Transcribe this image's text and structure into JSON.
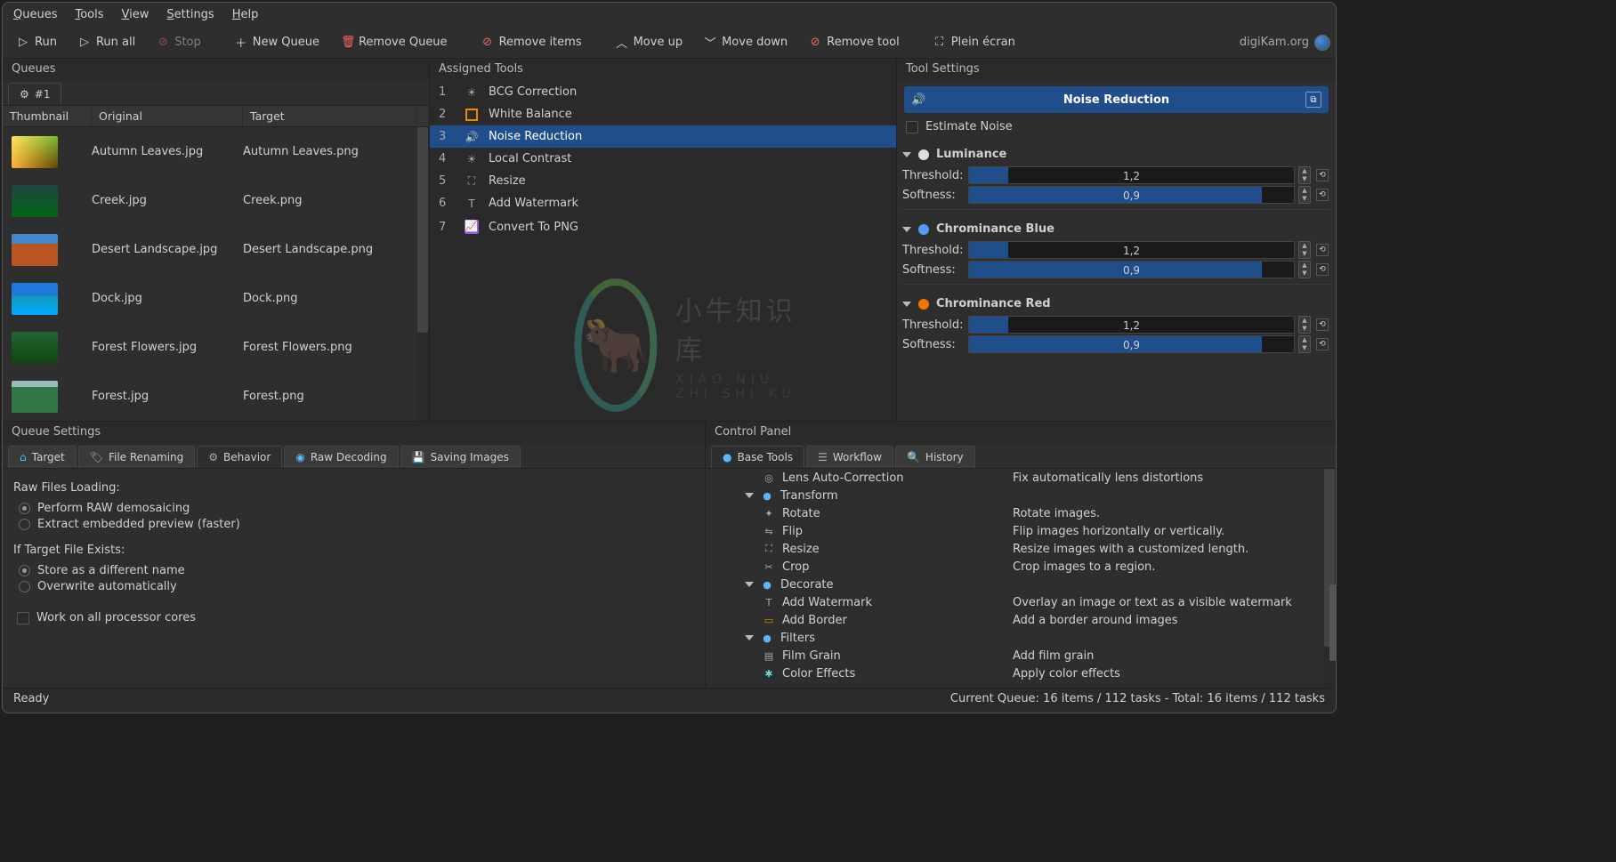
{
  "menubar": [
    "Queues",
    "Tools",
    "View",
    "Settings",
    "Help"
  ],
  "toolbar": {
    "run": "Run",
    "runall": "Run all",
    "stop": "Stop",
    "newqueue": "New Queue",
    "removequeue": "Remove Queue",
    "removeitems": "Remove items",
    "moveup": "Move up",
    "movedown": "Move down",
    "removetool": "Remove tool",
    "fullscreen": "Plein écran",
    "brand": "digiKam.org"
  },
  "queues": {
    "title": "Queues",
    "tab": "#1",
    "columns": {
      "thumb": "Thumbnail",
      "orig": "Original",
      "target": "Target"
    },
    "rows": [
      {
        "t": "t1",
        "o": "Autumn Leaves.jpg",
        "g": "Autumn Leaves.png"
      },
      {
        "t": "t2",
        "o": "Creek.jpg",
        "g": "Creek.png"
      },
      {
        "t": "t3",
        "o": "Desert Landscape.jpg",
        "g": "Desert Landscape.png"
      },
      {
        "t": "t4",
        "o": "Dock.jpg",
        "g": "Dock.png"
      },
      {
        "t": "t5",
        "o": "Forest Flowers.jpg",
        "g": "Forest Flowers.png"
      },
      {
        "t": "t6",
        "o": "Forest.jpg",
        "g": "Forest.png"
      }
    ]
  },
  "assigned": {
    "title": "Assigned Tools",
    "rows": [
      {
        "n": "1",
        "name": "BCG Correction",
        "icon": "sun"
      },
      {
        "n": "2",
        "name": "White Balance",
        "icon": "sq-orange"
      },
      {
        "n": "3",
        "name": "Noise Reduction",
        "icon": "speaker",
        "sel": true
      },
      {
        "n": "4",
        "name": "Local Contrast",
        "icon": "sun"
      },
      {
        "n": "5",
        "name": "Resize",
        "icon": "resize"
      },
      {
        "n": "6",
        "name": "Add Watermark",
        "icon": "text"
      },
      {
        "n": "7",
        "name": "Convert To PNG",
        "icon": "sq-purple"
      }
    ],
    "wm_big": "小牛知识库",
    "wm_sub": "XIAO NIU ZHI SHI KU"
  },
  "toolsettings": {
    "title": "Tool Settings",
    "header": "Noise Reduction",
    "estimate": "Estimate Noise",
    "groups": [
      {
        "name": "Luminance",
        "bulb": "#ddd",
        "rows": [
          {
            "lab": "Threshold:",
            "val": "1,2",
            "fill": 12
          },
          {
            "lab": "Softness:",
            "val": "0,9",
            "fill": 90
          }
        ]
      },
      {
        "name": "Chrominance Blue",
        "bulb": "#59f",
        "rows": [
          {
            "lab": "Threshold:",
            "val": "1,2",
            "fill": 12
          },
          {
            "lab": "Softness:",
            "val": "0,9",
            "fill": 90
          }
        ]
      },
      {
        "name": "Chrominance Red",
        "bulb": "#e70",
        "rows": [
          {
            "lab": "Threshold:",
            "val": "1,2",
            "fill": 12
          },
          {
            "lab": "Softness:",
            "val": "0,9",
            "fill": 90
          }
        ]
      }
    ]
  },
  "queuesettings": {
    "title": "Queue Settings",
    "tabs": [
      "Target",
      "File Renaming",
      "Behavior",
      "Raw Decoding",
      "Saving Images"
    ],
    "active": 2,
    "h1": "Raw Files Loading:",
    "r1": "Perform RAW demosaicing",
    "r2": "Extract embedded preview (faster)",
    "h2": "If Target File Exists:",
    "r3": "Store as a different name",
    "r4": "Overwrite automatically",
    "chk": "Work on all processor cores"
  },
  "controlpanel": {
    "title": "Control Panel",
    "tabs": [
      "Base Tools",
      "Workflow",
      "History"
    ],
    "active": 0,
    "rows": [
      {
        "ind": 1,
        "icon": "◎",
        "cls": "",
        "name": "Lens Auto-Correction",
        "desc": "Fix automatically lens distortions"
      },
      {
        "ind": 0,
        "exp": true,
        "icon": "●",
        "cls": "blue",
        "name": "Transform",
        "desc": ""
      },
      {
        "ind": 1,
        "icon": "✦",
        "name": "Rotate",
        "desc": "Rotate images."
      },
      {
        "ind": 1,
        "icon": "⇋",
        "name": "Flip",
        "desc": "Flip images horizontally or vertically."
      },
      {
        "ind": 1,
        "icon": "⛶",
        "name": "Resize",
        "desc": "Resize images with a customized length."
      },
      {
        "ind": 1,
        "icon": "✂",
        "name": "Crop",
        "desc": "Crop images to a region."
      },
      {
        "ind": 0,
        "exp": true,
        "icon": "●",
        "cls": "blue",
        "name": "Decorate",
        "desc": ""
      },
      {
        "ind": 1,
        "icon": "T",
        "name": "Add Watermark",
        "desc": "Overlay an image or text as a visible watermark"
      },
      {
        "ind": 1,
        "icon": "▭",
        "cls": "orange",
        "name": "Add Border",
        "desc": "Add a border around images"
      },
      {
        "ind": 0,
        "exp": true,
        "icon": "●",
        "cls": "blue",
        "name": "Filters",
        "desc": ""
      },
      {
        "ind": 1,
        "icon": "▤",
        "name": "Film Grain",
        "desc": "Add film grain"
      },
      {
        "ind": 1,
        "icon": "✱",
        "cls": "cyan",
        "name": "Color Effects",
        "desc": "Apply color effects"
      }
    ]
  },
  "status": {
    "left": "Ready",
    "right": "Current Queue: 16 items / 112 tasks - Total: 16 items / 112 tasks"
  }
}
